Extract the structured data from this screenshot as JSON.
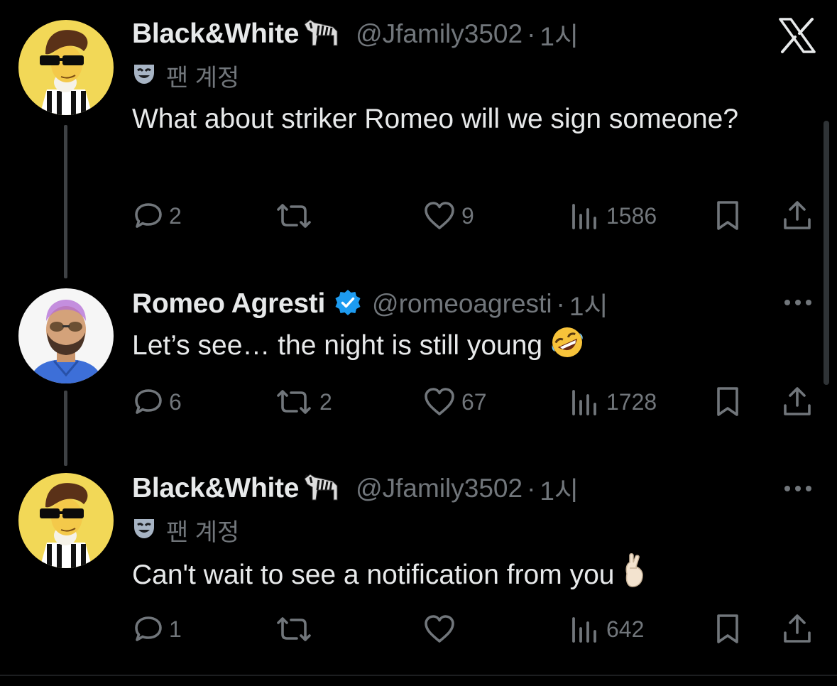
{
  "app": {
    "brand": "X",
    "accent": "#1d9bf0",
    "text_color": "#e7e9ea",
    "muted_color": "#71767b",
    "background": "#000000"
  },
  "tweets": [
    {
      "display_name": "Black&White",
      "name_emoji": "zebra-emoji",
      "handle": "@Jfamily3502",
      "separator": "·",
      "time": "1시",
      "fan_label": "팬 계정",
      "text": "What about striker Romeo will we sign someone?",
      "replies": "2",
      "reposts": "",
      "likes": "9",
      "views": "1586"
    },
    {
      "display_name": "Romeo Agresti",
      "verified": true,
      "handle": "@romeoagresti",
      "separator": "·",
      "time": "1시",
      "text": "Let’s see… the night is still young",
      "text_emoji": "rolling-on-floor-laughing-emoji",
      "replies": "6",
      "reposts": "2",
      "likes": "67",
      "views": "1728"
    },
    {
      "display_name": "Black&White",
      "name_emoji": "zebra-emoji",
      "handle": "@Jfamily3502",
      "separator": "·",
      "time": "1시",
      "fan_label": "팬 계정",
      "text": "Can't wait to see a notification from you",
      "text_emoji": "crossed-fingers-emoji",
      "replies": "1",
      "reposts": "",
      "likes": "",
      "views": "642"
    }
  ]
}
